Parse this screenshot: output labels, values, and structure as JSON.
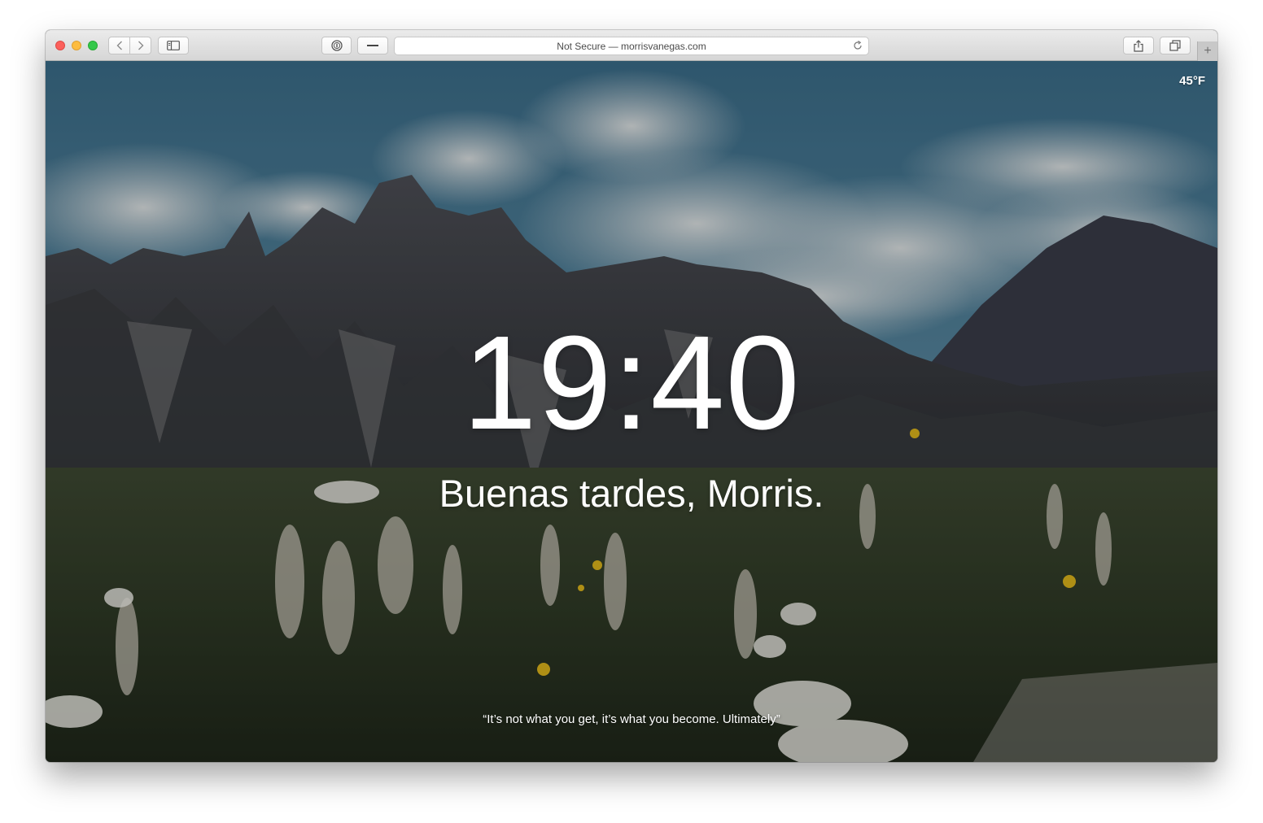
{
  "browser": {
    "address_bar": "Not Secure — morrisvanegas.com",
    "toolbar_icons": [
      "back-icon",
      "forward-icon",
      "sidebar-icon",
      "password-icon",
      "minus-icon",
      "reload-icon",
      "share-icon",
      "tabs-overview-icon",
      "new-tab-icon"
    ],
    "new_tab_label": "+"
  },
  "page": {
    "temperature": "45°F",
    "time": "19:40",
    "greeting": "Buenas tardes, Morris.",
    "quote": "“It’s not what you get, it’s what you become. Ultimately”"
  },
  "colors": {
    "close": "#fc605c",
    "minimize": "#fdbc40",
    "zoom": "#34c84a",
    "text": "#ffffff"
  }
}
